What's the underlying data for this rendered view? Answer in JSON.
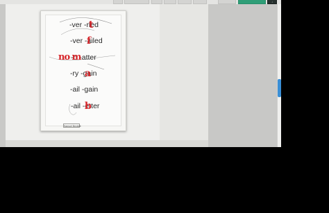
{
  "toolbar": {
    "buttons": [
      "",
      "",
      "",
      "",
      "",
      "",
      ""
    ],
    "share_label": "",
    "download_icon": "download-icon"
  },
  "poster": {
    "lines": [
      {
        "text": "-ver  -ried",
        "mark": "t"
      },
      {
        "text": "-ver  -ailed",
        "mark": "f"
      },
      {
        "text": "-o  -atter",
        "mark": "no m"
      },
      {
        "text": "-ry  -gain",
        "mark": "a"
      },
      {
        "text": "-ail  -gain",
        "mark": ""
      },
      {
        "text": "-ail  -etter",
        "mark": "b"
      }
    ],
    "footer": "Samuel Beckett"
  },
  "colors": {
    "accent_red": "#d7262b",
    "toolbar_green": "#2f9e77",
    "scroll_blue": "#3a8fd6"
  }
}
